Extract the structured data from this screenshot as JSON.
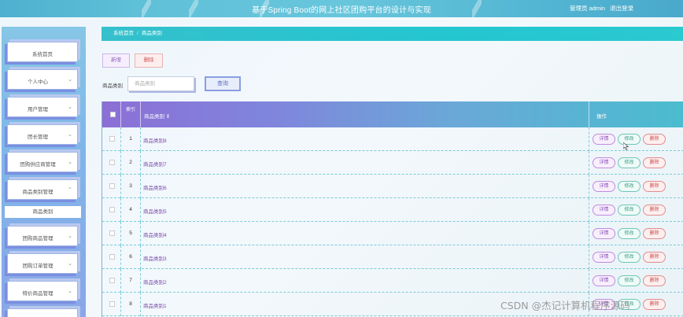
{
  "header": {
    "title": "基于Spring Boot的网上社区团购平台的设计与实现",
    "user_label": "管理员 admin",
    "logout_label": "退出登录"
  },
  "sidebar": {
    "items": [
      {
        "label": "系统首页",
        "chevron": false
      },
      {
        "label": "个人中心",
        "chevron": true
      },
      {
        "label": "用户管理",
        "chevron": true
      },
      {
        "label": "团长管理",
        "chevron": true
      },
      {
        "label": "团购供应商管理",
        "chevron": true
      },
      {
        "label": "商品类别管理",
        "chevron": true,
        "expanded": true
      },
      {
        "label": "团购商品管理",
        "chevron": true
      },
      {
        "label": "团购订单管理",
        "chevron": true
      },
      {
        "label": "特价商品管理",
        "chevron": true
      }
    ],
    "submenu": {
      "label": "商品类别"
    }
  },
  "breadcrumb": {
    "home": "系统首页",
    "separator": "/",
    "current": "商品类别"
  },
  "toolbar": {
    "add_label": "新增",
    "delete_label": "删除"
  },
  "search": {
    "label": "商品类别",
    "placeholder": "商品类别",
    "button_label": "查询"
  },
  "table": {
    "headers": {
      "index": "索引",
      "name": "商品类别 ⇕",
      "ops": "操作"
    },
    "rows": [
      {
        "index": "1",
        "name": "商品类别8"
      },
      {
        "index": "2",
        "name": "商品类别7"
      },
      {
        "index": "3",
        "name": "商品类别6"
      },
      {
        "index": "4",
        "name": "商品类别5"
      },
      {
        "index": "5",
        "name": "商品类别4"
      },
      {
        "index": "6",
        "name": "商品类别3"
      },
      {
        "index": "7",
        "name": "商品类别2"
      },
      {
        "index": "8",
        "name": "商品类别1"
      }
    ],
    "row_actions": {
      "detail": "详情",
      "edit": "修改",
      "delete": "删除"
    }
  },
  "watermark": "CSDN @杰记计算机程序源码",
  "colors": {
    "topbar": "#5fc0d8",
    "breadcrumb": "#24c6d0",
    "accent_purple": "#8c6fd6",
    "sidebar": "#7fb7e8"
  }
}
